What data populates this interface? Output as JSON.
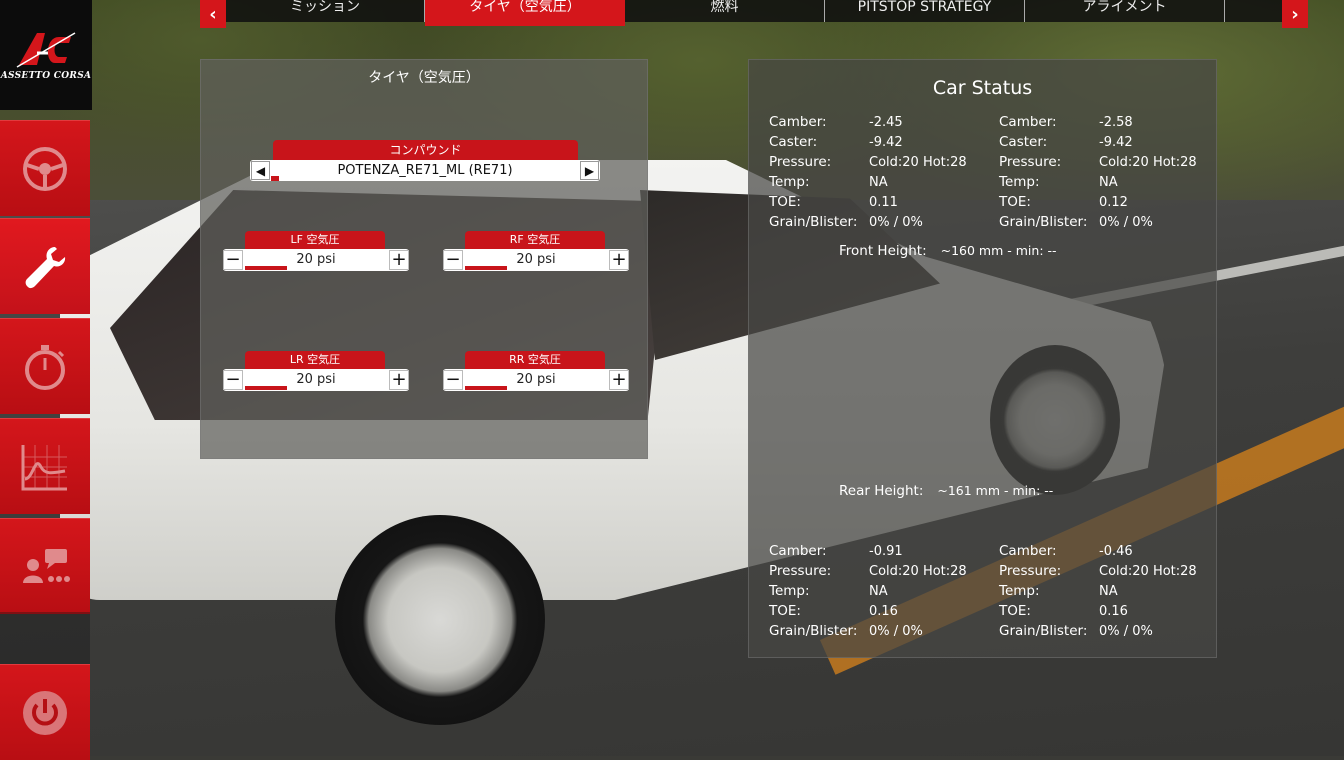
{
  "brand": {
    "logo_text": "ASSETTO CORSA",
    "accent": "#d4161b"
  },
  "sidebar": {
    "items": [
      {
        "icon": "steering-wheel-icon"
      },
      {
        "icon": "wrench-icon"
      },
      {
        "icon": "stopwatch-icon"
      },
      {
        "icon": "telemetry-chart-icon"
      },
      {
        "icon": "driver-chat-icon"
      },
      {
        "icon": "power-icon"
      }
    ]
  },
  "tabs": {
    "prev_arrow": "‹",
    "next_arrow": "›",
    "items": [
      {
        "label": "ミッション"
      },
      {
        "label": "タイヤ（空気圧）"
      },
      {
        "label": "燃料"
      },
      {
        "label": "PITSTOP STRATEGY"
      },
      {
        "label": "アライメント"
      }
    ],
    "active_index": 1
  },
  "tyre_panel": {
    "title": "タイヤ（空気圧）",
    "compound": {
      "label": "コンパウンド",
      "value": "POTENZA_RE71_ML (RE71)",
      "prev": "◀",
      "next": "▶"
    },
    "pressures": [
      {
        "label": "LF 空気圧",
        "value": "20 psi"
      },
      {
        "label": "RF 空気圧",
        "value": "20 psi"
      },
      {
        "label": "LR 空気圧",
        "value": "20 psi"
      },
      {
        "label": "RR 空気圧",
        "value": "20 psi"
      }
    ],
    "minus": "−",
    "plus": "+"
  },
  "car_status": {
    "title": "Car Status",
    "front_left": [
      {
        "k": "Camber:",
        "v": "-2.45"
      },
      {
        "k": "Caster:",
        "v": "-9.42"
      },
      {
        "k": "Pressure:",
        "v": "Cold:20 Hot:28"
      },
      {
        "k": "Temp:",
        "v": "NA"
      },
      {
        "k": "TOE:",
        "v": "0.11"
      },
      {
        "k": "Grain/Blister:",
        "v": "0% / 0%"
      }
    ],
    "front_right": [
      {
        "k": "Camber:",
        "v": "-2.58"
      },
      {
        "k": "Caster:",
        "v": "-9.42"
      },
      {
        "k": "Pressure:",
        "v": "Cold:20 Hot:28"
      },
      {
        "k": "Temp:",
        "v": "NA"
      },
      {
        "k": "TOE:",
        "v": "0.12"
      },
      {
        "k": "Grain/Blister:",
        "v": "0% / 0%"
      }
    ],
    "front_height": {
      "label": "Front Height:",
      "value": "~160 mm - min: --"
    },
    "rear_height": {
      "label": "Rear Height:",
      "value": "~161 mm - min: --"
    },
    "rear_left": [
      {
        "k": "Camber:",
        "v": "-0.91"
      },
      {
        "k": "Pressure:",
        "v": "Cold:20 Hot:28"
      },
      {
        "k": "Temp:",
        "v": "NA"
      },
      {
        "k": "TOE:",
        "v": "0.16"
      },
      {
        "k": "Grain/Blister:",
        "v": "0% / 0%"
      }
    ],
    "rear_right": [
      {
        "k": "Camber:",
        "v": "-0.46"
      },
      {
        "k": "Pressure:",
        "v": "Cold:20 Hot:28"
      },
      {
        "k": "Temp:",
        "v": "NA"
      },
      {
        "k": "TOE:",
        "v": "0.16"
      },
      {
        "k": "Grain/Blister:",
        "v": "0% / 0%"
      }
    ]
  }
}
